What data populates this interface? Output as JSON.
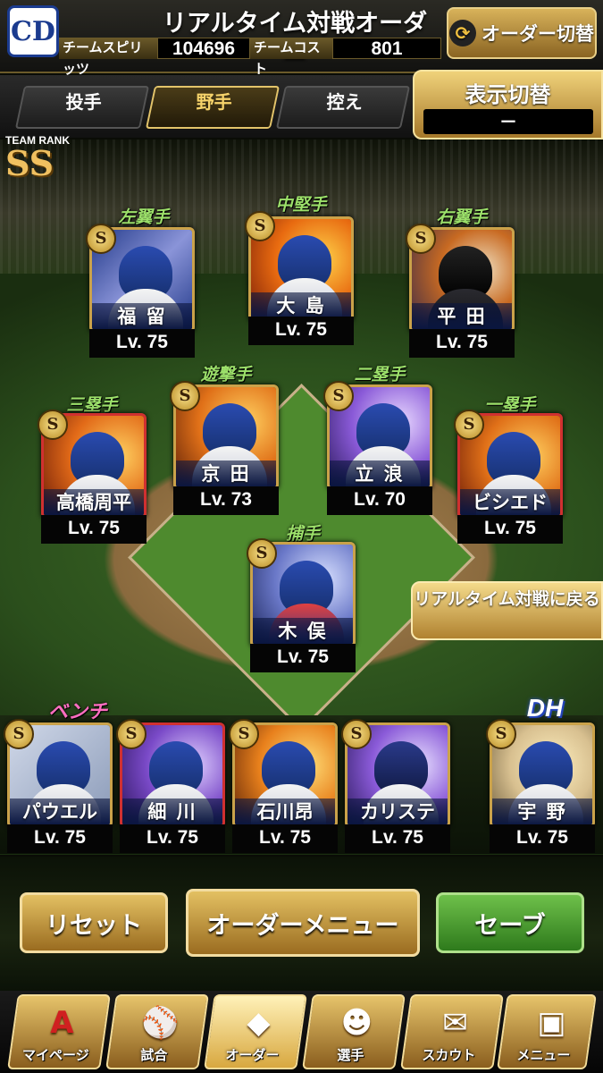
{
  "header": {
    "logo_text": "CD",
    "title": "リアルタイム対戦オーダー",
    "team_spirits_label": "チームスピリッツ",
    "team_spirits_value": "104696",
    "team_cost_label": "チームコスト",
    "team_cost_value": "801",
    "order_switch_label": "オーダー切替"
  },
  "tabs": [
    {
      "label": "投手"
    },
    {
      "label": "野手"
    },
    {
      "label": "控え"
    }
  ],
  "active_tab": "野手",
  "display_toggle": {
    "label": "表示切替",
    "value": "－"
  },
  "team_rank": {
    "label": "TEAM RANK",
    "value": "SS"
  },
  "positions": {
    "lf": {
      "pos": "左翼手",
      "name": "福 留",
      "level": "Lv. 75",
      "badge": "S"
    },
    "cf": {
      "pos": "中堅手",
      "name": "大 島",
      "level": "Lv. 75",
      "badge": "S"
    },
    "rf": {
      "pos": "右翼手",
      "name": "平 田",
      "level": "Lv. 75",
      "badge": "S"
    },
    "b3": {
      "pos": "三塁手",
      "name": "高橋周平",
      "level": "Lv. 75",
      "badge": "S"
    },
    "ss": {
      "pos": "遊撃手",
      "name": "京 田",
      "level": "Lv. 73",
      "badge": "S"
    },
    "b2": {
      "pos": "二塁手",
      "name": "立 浪",
      "level": "Lv. 70",
      "badge": "S"
    },
    "b1": {
      "pos": "一塁手",
      "name": "ビシエド",
      "level": "Lv. 75",
      "badge": "S"
    },
    "c": {
      "pos": "捕手",
      "name": "木 俣",
      "level": "Lv. 75",
      "badge": "S"
    }
  },
  "return_button_label": "リアルタイム対戦に戻る",
  "bench_label": "ベンチ",
  "bench": [
    {
      "name": "パウエル",
      "level": "Lv. 75"
    },
    {
      "name": "細 川",
      "level": "Lv. 75"
    },
    {
      "name": "石川昂",
      "level": "Lv. 75"
    },
    {
      "name": "カリステ",
      "level": "Lv. 75"
    }
  ],
  "dh_label": "DH",
  "dh": {
    "name": "宇 野",
    "level": "Lv. 75"
  },
  "buttons": {
    "reset": "リセット",
    "order_menu": "オーダーメニュー",
    "save": "セーブ"
  },
  "nav": [
    {
      "label": "マイページ",
      "icon": "A"
    },
    {
      "label": "試合",
      "icon": "⚾"
    },
    {
      "label": "オーダー",
      "icon": "◆"
    },
    {
      "label": "選手",
      "icon": "☻"
    },
    {
      "label": "スカウト",
      "icon": "✉"
    },
    {
      "label": "メニュー",
      "icon": "▣"
    }
  ],
  "colors": {
    "accent_gold": "#caa24a",
    "position_green": "#9ce06a",
    "bench_pink": "#ff6ec0",
    "save_green": "#4a9e30"
  }
}
